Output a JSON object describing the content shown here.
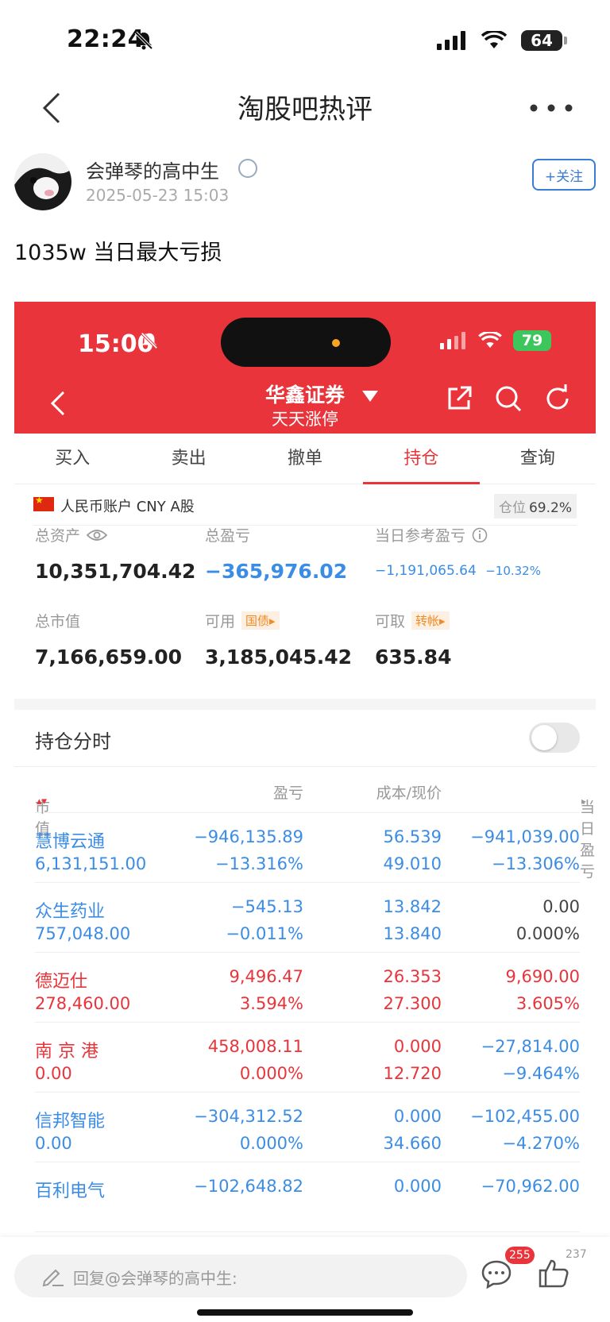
{
  "status_bar": {
    "time": "22:24",
    "battery": "64"
  },
  "nav": {
    "title": "淘股吧热评"
  },
  "post": {
    "author": "会弹琴的高中生",
    "date": "2025-05-23 15:03",
    "follow_label": "+关注",
    "text": "1035w 当日最大亏损"
  },
  "screenshot": {
    "status_time": "15:00",
    "battery": "79",
    "broker": "华鑫证券",
    "broker_sub": "天天涨停",
    "tabs": [
      "买入",
      "卖出",
      "撤单",
      "持仓",
      "查询"
    ],
    "active_tab": "持仓",
    "account": "人民币账户 CNY A股",
    "position_label": "仓位",
    "position_value": "69.2%",
    "metrics": {
      "total_assets_label": "总资产",
      "total_assets": "10,351,704.42",
      "total_pnl_label": "总盈亏",
      "total_pnl": "−365,976.02",
      "daily_pnl_label": "当日参考盈亏",
      "daily_pnl": "−1,191,065.64",
      "daily_pnl_pct": "−10.32%",
      "market_value_label": "总市值",
      "market_value": "7,166,659.00",
      "available_label": "可用",
      "available_tag": "国债▸",
      "available": "3,185,045.42",
      "withdrawable_label": "可取",
      "withdrawable_tag": "转帐▸",
      "withdrawable": "635.84"
    },
    "split_label": "持仓分时",
    "columns": [
      "市值",
      "盈亏",
      "成本/现价",
      "当日盈亏"
    ],
    "holdings": [
      {
        "name": "慧博云通",
        "mv": "6,131,151.00",
        "pnl": "−946,135.89",
        "pnl_pct": "−13.316%",
        "cost": "56.539",
        "price": "49.010",
        "day": "−941,039.00",
        "day_pct": "−13.306%",
        "tone": "blue",
        "day_tone": "blue"
      },
      {
        "name": "众生药业",
        "mv": "757,048.00",
        "pnl": "−545.13",
        "pnl_pct": "−0.011%",
        "cost": "13.842",
        "price": "13.840",
        "day": "0.00",
        "day_pct": "0.000%",
        "tone": "blue",
        "day_tone": "gray"
      },
      {
        "name": "德迈仕",
        "mv": "278,460.00",
        "pnl": "9,496.47",
        "pnl_pct": "3.594%",
        "cost": "26.353",
        "price": "27.300",
        "day": "9,690.00",
        "day_pct": "3.605%",
        "tone": "red",
        "day_tone": "red"
      },
      {
        "name": "南 京 港",
        "mv": "0.00",
        "pnl": "458,008.11",
        "pnl_pct": "0.000%",
        "cost": "0.000",
        "price": "12.720",
        "day": "−27,814.00",
        "day_pct": "−9.464%",
        "tone": "red",
        "day_tone": "blue"
      },
      {
        "name": "信邦智能",
        "mv": "0.00",
        "pnl": "−304,312.52",
        "pnl_pct": "0.000%",
        "cost": "0.000",
        "price": "34.660",
        "day": "−102,455.00",
        "day_pct": "−4.270%",
        "tone": "blue",
        "day_tone": "blue"
      },
      {
        "name": "百利电气",
        "mv": "",
        "pnl": "−102,648.82",
        "pnl_pct": "",
        "cost": "0.000",
        "price": "",
        "day": "−70,962.00",
        "day_pct": "",
        "tone": "blue",
        "day_tone": "blue"
      }
    ]
  },
  "bottom": {
    "reply_placeholder": "回复@会弹琴的高中生:",
    "comment_count": "255",
    "like_count": "237"
  },
  "colors": {
    "accent_red": "#e8343a",
    "loss_blue": "#3b8ce5",
    "link_blue": "#3a7bd5"
  }
}
